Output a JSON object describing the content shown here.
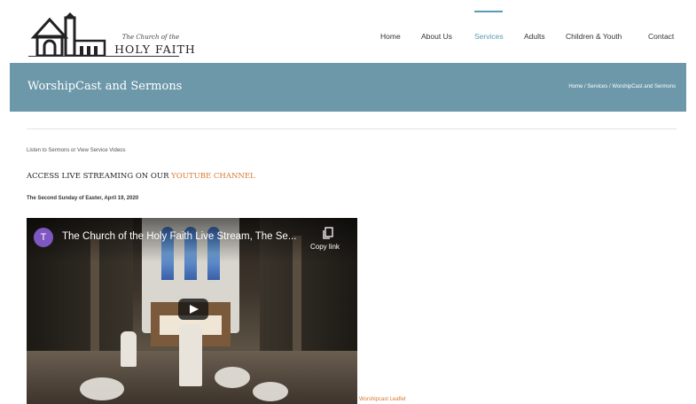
{
  "logo": {
    "small_text": "The Church of the",
    "big_text": "HOLY FAITH"
  },
  "nav": {
    "items": [
      {
        "label": "Home"
      },
      {
        "label": "About Us"
      },
      {
        "label": "Services",
        "active": true
      },
      {
        "label": "Adults"
      },
      {
        "label": "Children & Youth"
      },
      {
        "label": "Contact"
      }
    ]
  },
  "titlebar": {
    "title": "WorshipCast and Sermons",
    "breadcrumb": [
      "Home",
      "Services",
      "WorshipCast and Sermons"
    ],
    "separator": " / "
  },
  "content": {
    "intro": "Listen to Sermons or View Service Videos",
    "live_prefix": "ACCESS LIVE STREAMING ON OUR ",
    "live_link": "YOUTUBE CHANNEL",
    "sunday": "The Second Sunday of Easter, April 19, 2020",
    "leaflet_link": "Worshipcast Leaflet"
  },
  "video": {
    "channel_initial": "T",
    "title": "The Church of the Holy Faith Live Stream, The Se...",
    "copy_label": "Copy link",
    "icons": [
      "copy-icon",
      "play-icon"
    ]
  },
  "colors": {
    "accent": "#5a9ab5",
    "titlebar": "#6d98a9",
    "link_orange": "#d8782e",
    "avatar": "#7e57c2"
  }
}
